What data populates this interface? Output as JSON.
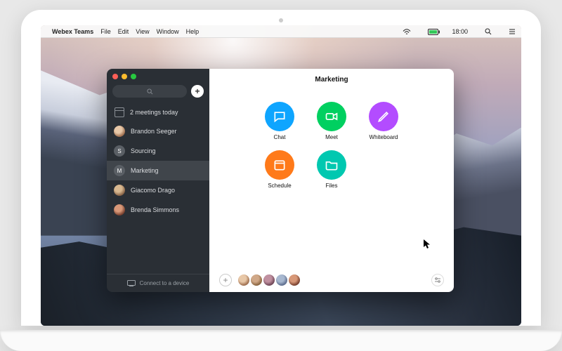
{
  "menubar": {
    "app_name": "Webex Teams",
    "items": [
      "File",
      "Edit",
      "View",
      "Window",
      "Help"
    ],
    "time": "18:00"
  },
  "sidebar": {
    "meetings_label": "2 meetings today",
    "items": [
      {
        "label": "Brandon Seeger",
        "initial": ""
      },
      {
        "label": "Sourcing",
        "initial": "S"
      },
      {
        "label": "Marketing",
        "initial": "M"
      },
      {
        "label": "Giacomo Drago",
        "initial": ""
      },
      {
        "label": "Brenda Simmons",
        "initial": ""
      }
    ],
    "connect_label": "Connect to a device"
  },
  "main": {
    "title": "Marketing",
    "tiles": {
      "chat": "Chat",
      "meet": "Meet",
      "whiteboard": "Whiteboard",
      "schedule": "Schedule",
      "files": "Files"
    }
  }
}
